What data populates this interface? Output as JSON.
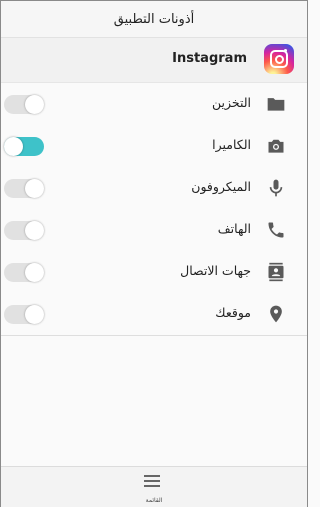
{
  "header": {
    "title": "أذونات التطبيق"
  },
  "app": {
    "name": "Instagram",
    "icon": "instagram-logo"
  },
  "permissions": [
    {
      "label": "التخزين",
      "icon": "folder-icon",
      "enabled": false
    },
    {
      "label": "الكاميرا",
      "icon": "camera-icon",
      "enabled": true
    },
    {
      "label": "الميكروفون",
      "icon": "microphone-icon",
      "enabled": false
    },
    {
      "label": "الهاتف",
      "icon": "phone-icon",
      "enabled": false
    },
    {
      "label": "جهات الاتصال",
      "icon": "contacts-icon",
      "enabled": false
    },
    {
      "label": "موقعك",
      "icon": "location-pin-icon",
      "enabled": false
    }
  ],
  "bottom_bar": {
    "menu_label": "القائمة",
    "icon": "menu-icon"
  },
  "colors": {
    "toggle_on": "#3ec2c9",
    "toggle_off": "#e1e1e1",
    "icon": "#5a5a5a"
  }
}
